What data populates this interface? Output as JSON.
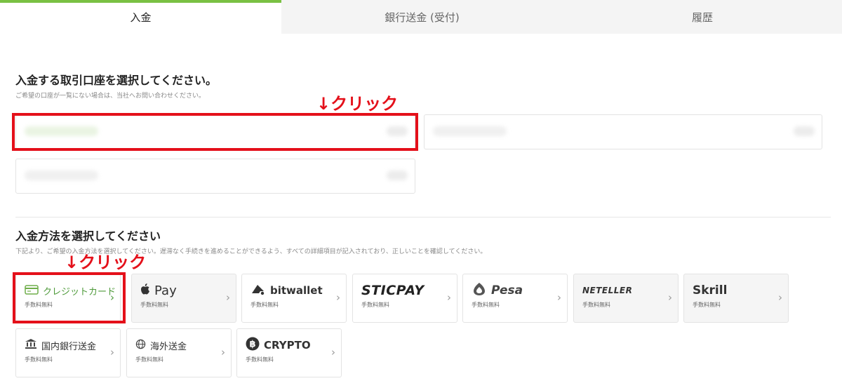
{
  "tabs": [
    {
      "label": "入金",
      "active": true
    },
    {
      "label": "銀行送金 (受付)",
      "active": false
    },
    {
      "label": "履歴",
      "active": false
    }
  ],
  "accounts_section": {
    "title": "入金する取引口座を選択してください。",
    "note": "ご希望の口座が一覧にない場合は、当社へお問い合わせください。"
  },
  "methods_section": {
    "title": "入金方法を選択してください",
    "note": "下記より、ご希望の入金方法を選択してください。遅滞なく手続きを進めることができるよう、すべての詳細項目が記入されており、正しいことを確認してください。"
  },
  "methods": [
    {
      "label": "クレジットカード",
      "fee": "手数料無料",
      "icon": "credit-card-icon"
    },
    {
      "label": "Pay",
      "fee": "手数料無料",
      "icon": "apple-logo-icon"
    },
    {
      "label": "bitwallet",
      "fee": "手数料無料",
      "icon": "bitwallet-logo-icon"
    },
    {
      "label": "STICPAY",
      "fee": "手数料無料"
    },
    {
      "label": "Pesa",
      "fee": "手数料無料",
      "icon": "pesa-logo-icon"
    },
    {
      "label": "NETELLER",
      "fee": "手数料無料"
    },
    {
      "label": "Skrill",
      "fee": "手数料無料"
    },
    {
      "label": "国内銀行送金",
      "fee": "手数料無料",
      "icon": "bank-icon"
    },
    {
      "label": "海外送金",
      "fee": "手数料無料",
      "icon": "globe-icon"
    },
    {
      "label": "CRYPTO",
      "fee": "手数料無料",
      "icon": "bitcoin-icon"
    }
  ],
  "annotations": {
    "click_1": "↓クリック",
    "click_2": "↓クリック"
  },
  "colors": {
    "accent": "#7ac143",
    "highlight": "#e4101a",
    "selected_text": "#4e9a3a"
  }
}
